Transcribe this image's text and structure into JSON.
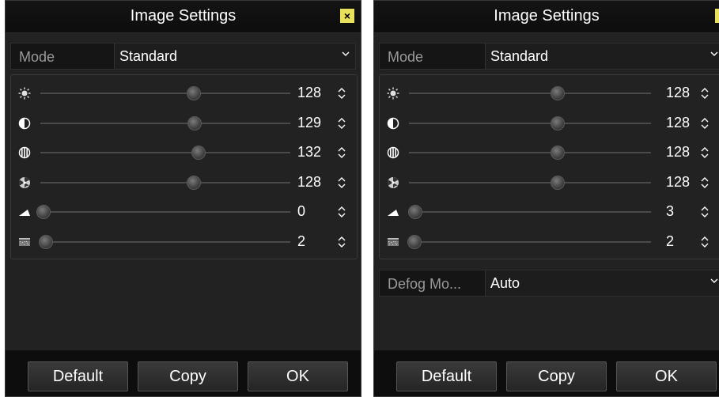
{
  "colors": {
    "accent": "#e9e15c",
    "background": "#222223",
    "titlebar": "#0d0d0d"
  },
  "left": {
    "title": "Image Settings",
    "close_glyph": "×",
    "mode": {
      "label": "Mode",
      "value": "Standard"
    },
    "adjustments": [
      {
        "icon": "brightness-icon",
        "value": "128",
        "level": 128
      },
      {
        "icon": "contrast-icon",
        "value": "129",
        "level": 129
      },
      {
        "icon": "saturation-icon",
        "value": "132",
        "level": 132
      },
      {
        "icon": "hue-icon",
        "value": "128",
        "level": 128
      },
      {
        "icon": "sharpness-icon",
        "value": "0",
        "level": 0
      },
      {
        "icon": "noise-reduction-icon",
        "value": "2",
        "level": 2
      }
    ],
    "buttons": {
      "default": "Default",
      "copy": "Copy",
      "ok": "OK"
    }
  },
  "right": {
    "title": "Image Settings",
    "close_glyph": "×",
    "mode": {
      "label": "Mode",
      "value": "Standard"
    },
    "adjustments": [
      {
        "icon": "brightness-icon",
        "value": "128",
        "level": 128
      },
      {
        "icon": "contrast-icon",
        "value": "128",
        "level": 128
      },
      {
        "icon": "saturation-icon",
        "value": "128",
        "level": 128
      },
      {
        "icon": "hue-icon",
        "value": "128",
        "level": 128
      },
      {
        "icon": "sharpness-icon",
        "value": "3",
        "level": 3
      },
      {
        "icon": "noise-reduction-icon",
        "value": "2",
        "level": 2
      }
    ],
    "defog": {
      "label": "Defog Mo...",
      "value": "Auto"
    },
    "buttons": {
      "default": "Default",
      "copy": "Copy",
      "ok": "OK"
    }
  }
}
